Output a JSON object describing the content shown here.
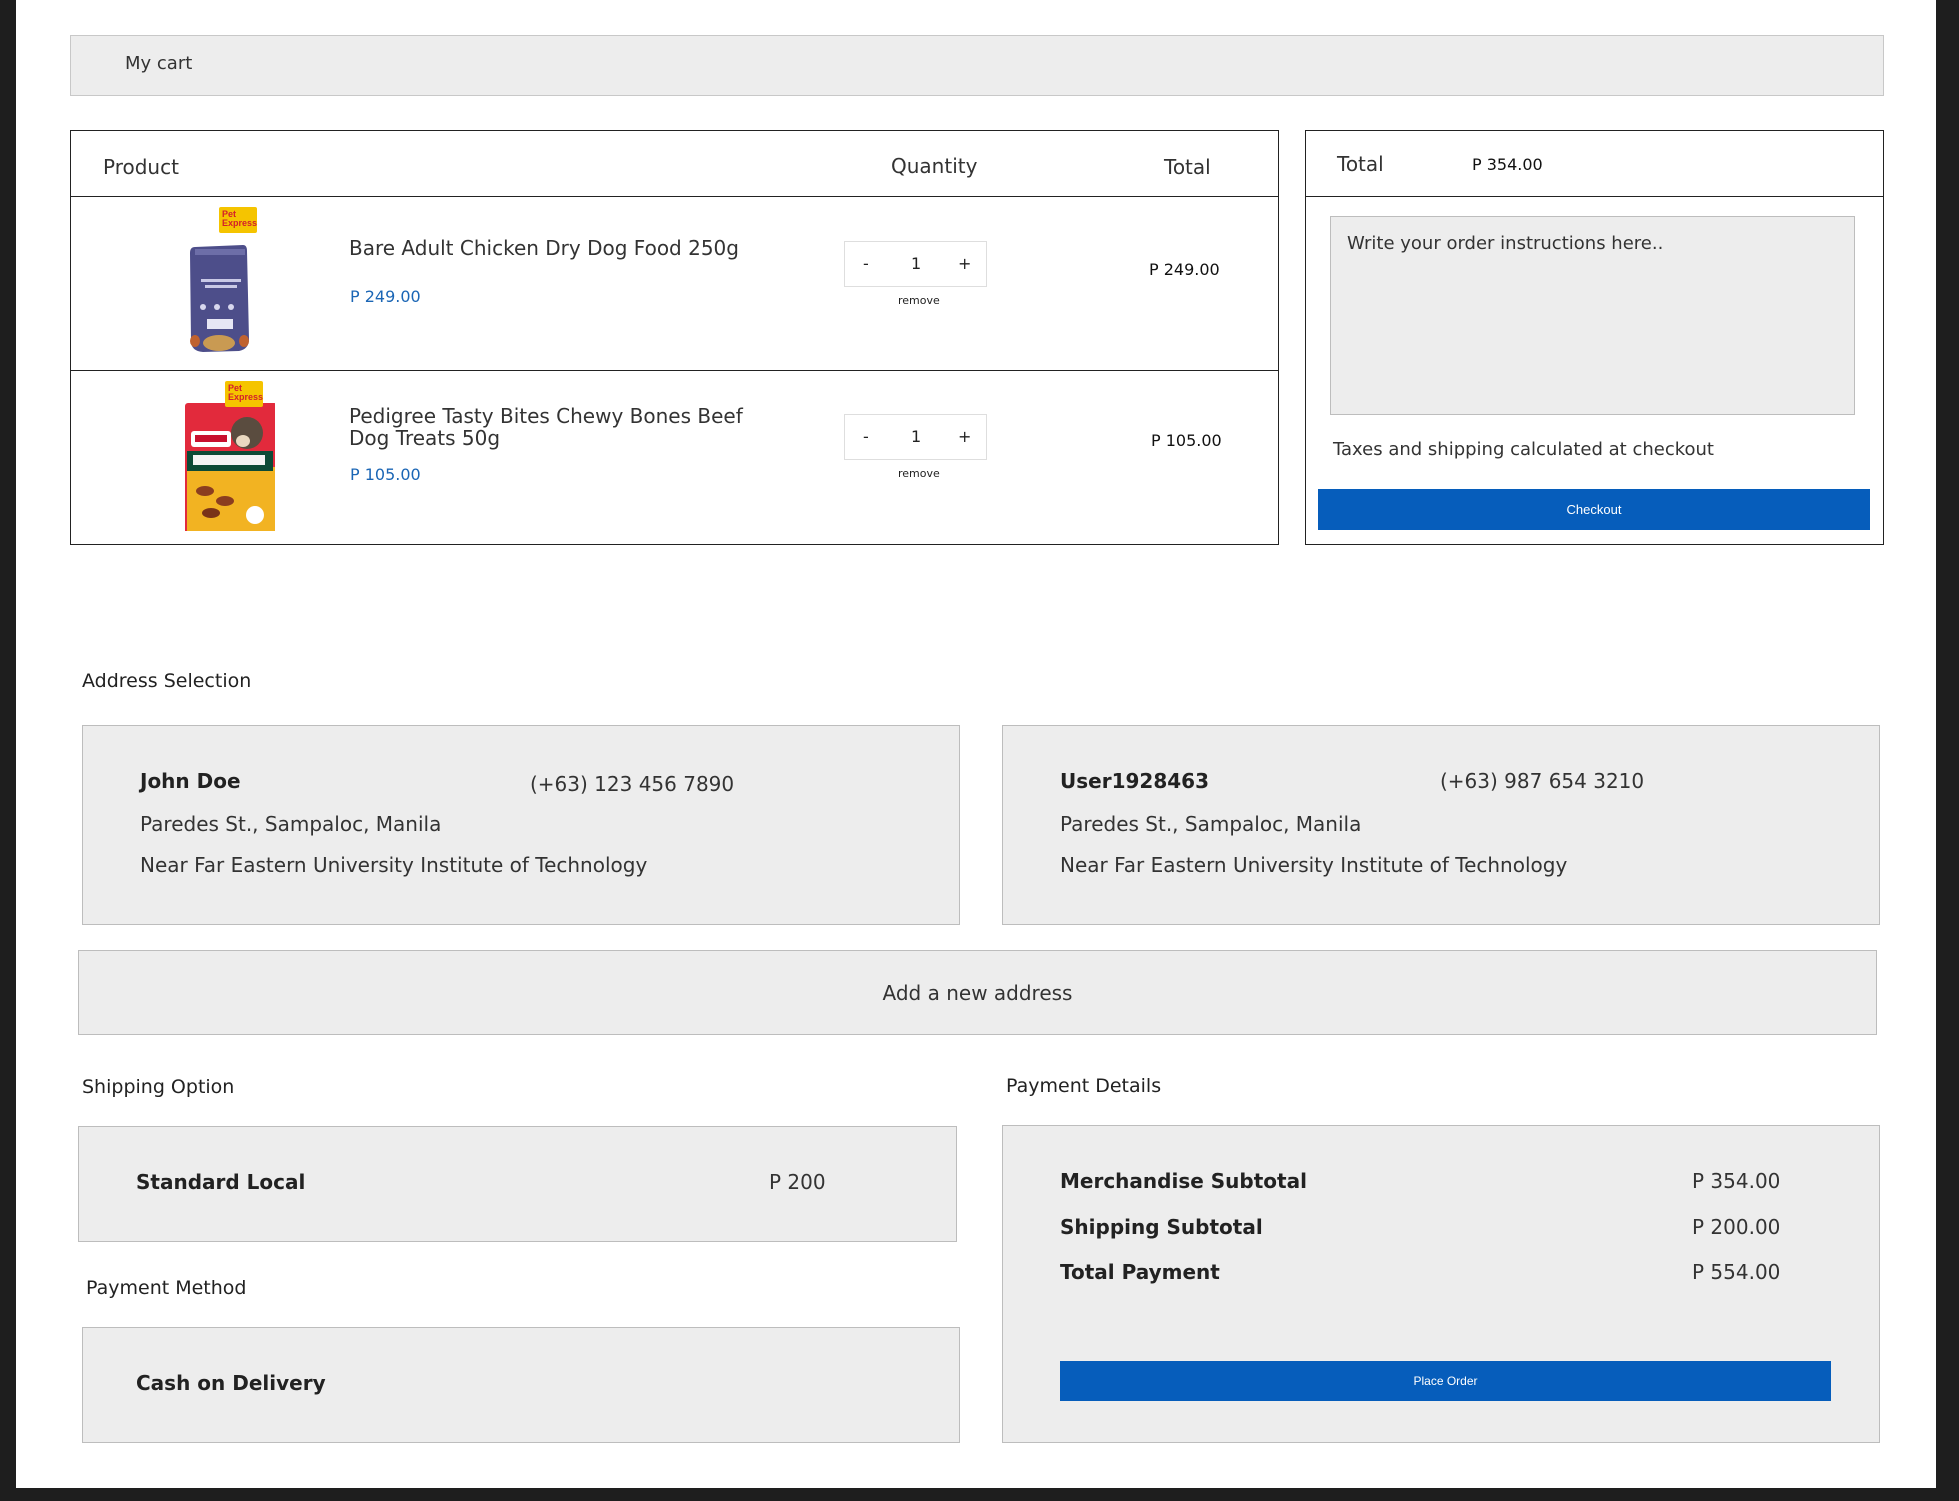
{
  "header": {
    "title": "My cart"
  },
  "cart": {
    "columns": {
      "product": "Product",
      "quantity": "Quantity",
      "total": "Total"
    },
    "items": [
      {
        "name": "Bare Adult Chicken Dry Dog Food 250g",
        "price": "P 249.00",
        "qty": "1",
        "total": "P 249.00",
        "image": "dog-food-bag-image",
        "badge": "Pet Express"
      },
      {
        "name": "Pedigree Tasty Bites Chewy Bones Beef Dog Treats 50g",
        "price": "P 105.00",
        "qty": "1",
        "total": "P 105.00",
        "image": "dog-treats-bag-image",
        "badge": "Pet Express"
      }
    ],
    "minus": "-",
    "plus": "+",
    "remove": "remove"
  },
  "summary": {
    "total_label": "Total",
    "total_value": "P 354.00",
    "instructions_placeholder": "Write your order instructions here..",
    "tax_note": "Taxes and shipping calculated at checkout",
    "checkout_label": "Checkout"
  },
  "address": {
    "title": "Address Selection",
    "cards": [
      {
        "name": "John Doe",
        "phone": "(+63) 123 456 7890",
        "line1": "Paredes St., Sampaloc, Manila",
        "line2": "Near Far Eastern University Institute of Technology"
      },
      {
        "name": "User1928463",
        "phone": "(+63) 987 654 3210",
        "line1": "Paredes St., Sampaloc, Manila",
        "line2": "Near Far Eastern University Institute of Technology"
      }
    ],
    "add_label": "Add a new address"
  },
  "shipping": {
    "title": "Shipping Option",
    "option": "Standard Local",
    "price": "P 200"
  },
  "payment_method": {
    "title": "Payment Method",
    "option": "Cash on Delivery"
  },
  "payment_details": {
    "title": "Payment Details",
    "rows": [
      {
        "label": "Merchandise Subtotal",
        "value": "P 354.00"
      },
      {
        "label": "Shipping Subtotal",
        "value": "P 200.00"
      },
      {
        "label": "Total Payment",
        "value": "P 554.00"
      }
    ],
    "place_order_label": "Place Order"
  },
  "colors": {
    "accent": "#065dbb",
    "price": "#1b66b5",
    "panel": "#ededed"
  }
}
